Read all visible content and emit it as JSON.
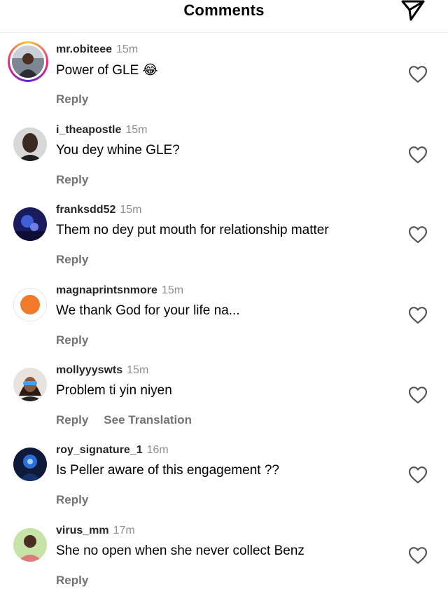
{
  "header": {
    "title": "Comments",
    "share_icon": "send-icon"
  },
  "colors": {
    "text": "#000000",
    "secondary": "#737373",
    "story_ring_start": "#f9ce34",
    "story_ring_end": "#6228d7"
  },
  "comments": [
    {
      "username": "mr.obiteee",
      "time": "15m",
      "text": "Power of GLE 😂",
      "reply": "Reply",
      "like_icon": "heart-outline-icon",
      "has_story": true
    },
    {
      "username": "i_theapostle",
      "time": "15m",
      "text": "You dey whine GLE?",
      "reply": "Reply",
      "like_icon": "heart-outline-icon"
    },
    {
      "username": "franksdd52",
      "time": "15m",
      "text": "Them no dey put mouth for relationship matter",
      "reply": "Reply",
      "like_icon": "heart-outline-icon"
    },
    {
      "username": "magnaprintsnmore",
      "time": "15m",
      "text": "We thank God for your life na...",
      "reply": "Reply",
      "like_icon": "heart-outline-icon"
    },
    {
      "username": "mollyyyswts",
      "time": "15m",
      "text": "Problem ti yin niyen",
      "reply": "Reply",
      "translation": "See Translation",
      "like_icon": "heart-outline-icon"
    },
    {
      "username": "roy_signature_1",
      "time": "16m",
      "text": "Is Peller aware of this engagement ??",
      "reply": "Reply",
      "like_icon": "heart-outline-icon"
    },
    {
      "username": "virus_mm",
      "time": "17m",
      "text": "She no open when she never collect Benz",
      "reply": "Reply",
      "like_icon": "heart-outline-icon"
    }
  ]
}
